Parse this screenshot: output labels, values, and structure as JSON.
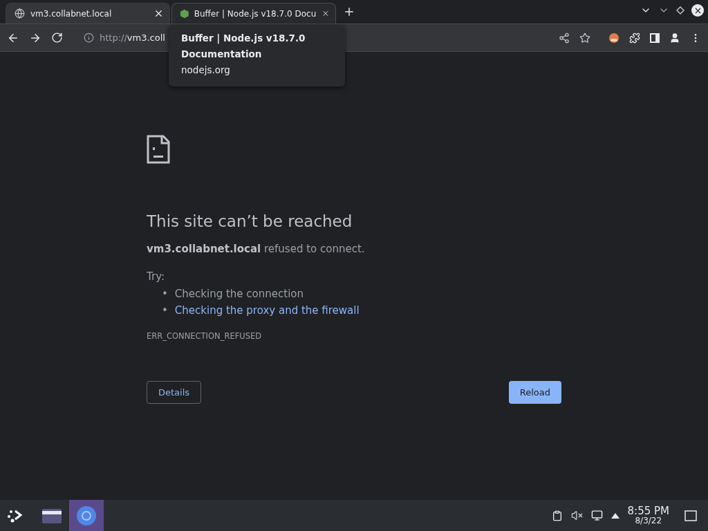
{
  "tabs": [
    {
      "title": "vm3.collabnet.local",
      "selected": true,
      "kind": "globe"
    },
    {
      "title": "Buffer | Node.js v18.7.0 Docu",
      "selected": false,
      "kind": "node"
    }
  ],
  "address": {
    "scheme": "http://",
    "host": "vm3.coll"
  },
  "tooltip": {
    "title": "Buffer | Node.js v18.7.0 Documentation",
    "host": "nodejs.org"
  },
  "error": {
    "heading": "This site can’t be reached",
    "message": "**vm3.collabnet.local** refused to connect.",
    "try_label": "Try:",
    "suggestions": [
      {
        "bullet": "•",
        "text": "Checking the connection",
        "kind": "text"
      },
      {
        "bullet": "•",
        "text": "Checking the proxy and the firewall",
        "kind": "link"
      }
    ],
    "code": "ERR_CONNECTION_REFUSED",
    "details_button": "Details",
    "reload_button": "Reload"
  },
  "taskbar": {
    "apps": [
      {
        "kind": "files",
        "selected": false
      },
      {
        "kind": "browser",
        "selected": true
      }
    ],
    "time": "8:55 PM",
    "date": "8/3/22"
  }
}
